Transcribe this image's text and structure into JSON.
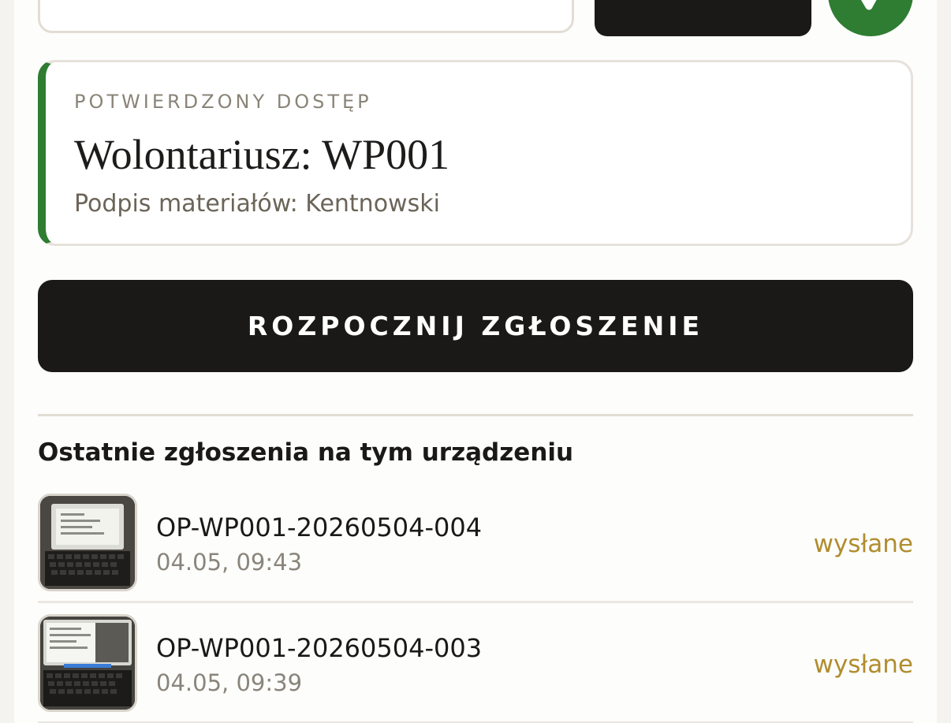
{
  "header": {
    "code_input_value": "",
    "verify_button_label": ""
  },
  "access_card": {
    "label": "POTWIERDZONY DOSTĘP",
    "title": "Wolontariusz: WP001",
    "subtitle": "Podpis materiałów: Kentnowski",
    "accent_color": "#2e7d32"
  },
  "start_button_label": "ROZPOCZNIJ ZGŁOSZENIE",
  "recent": {
    "title": "Ostatnie zgłoszenia na tym urządzeniu",
    "items": [
      {
        "code": "OP-WP001-20260504-004",
        "time": "04.05, 09:43",
        "status": "wysłane",
        "thumbnail_icon": "laptop-photo-icon"
      },
      {
        "code": "OP-WP001-20260504-003",
        "time": "04.05, 09:39",
        "status": "wysłane",
        "thumbnail_icon": "laptop-photo-icon"
      }
    ]
  },
  "colors": {
    "status": "#b08d2f",
    "button_bg": "#1a1917",
    "success": "#2e7d32"
  }
}
